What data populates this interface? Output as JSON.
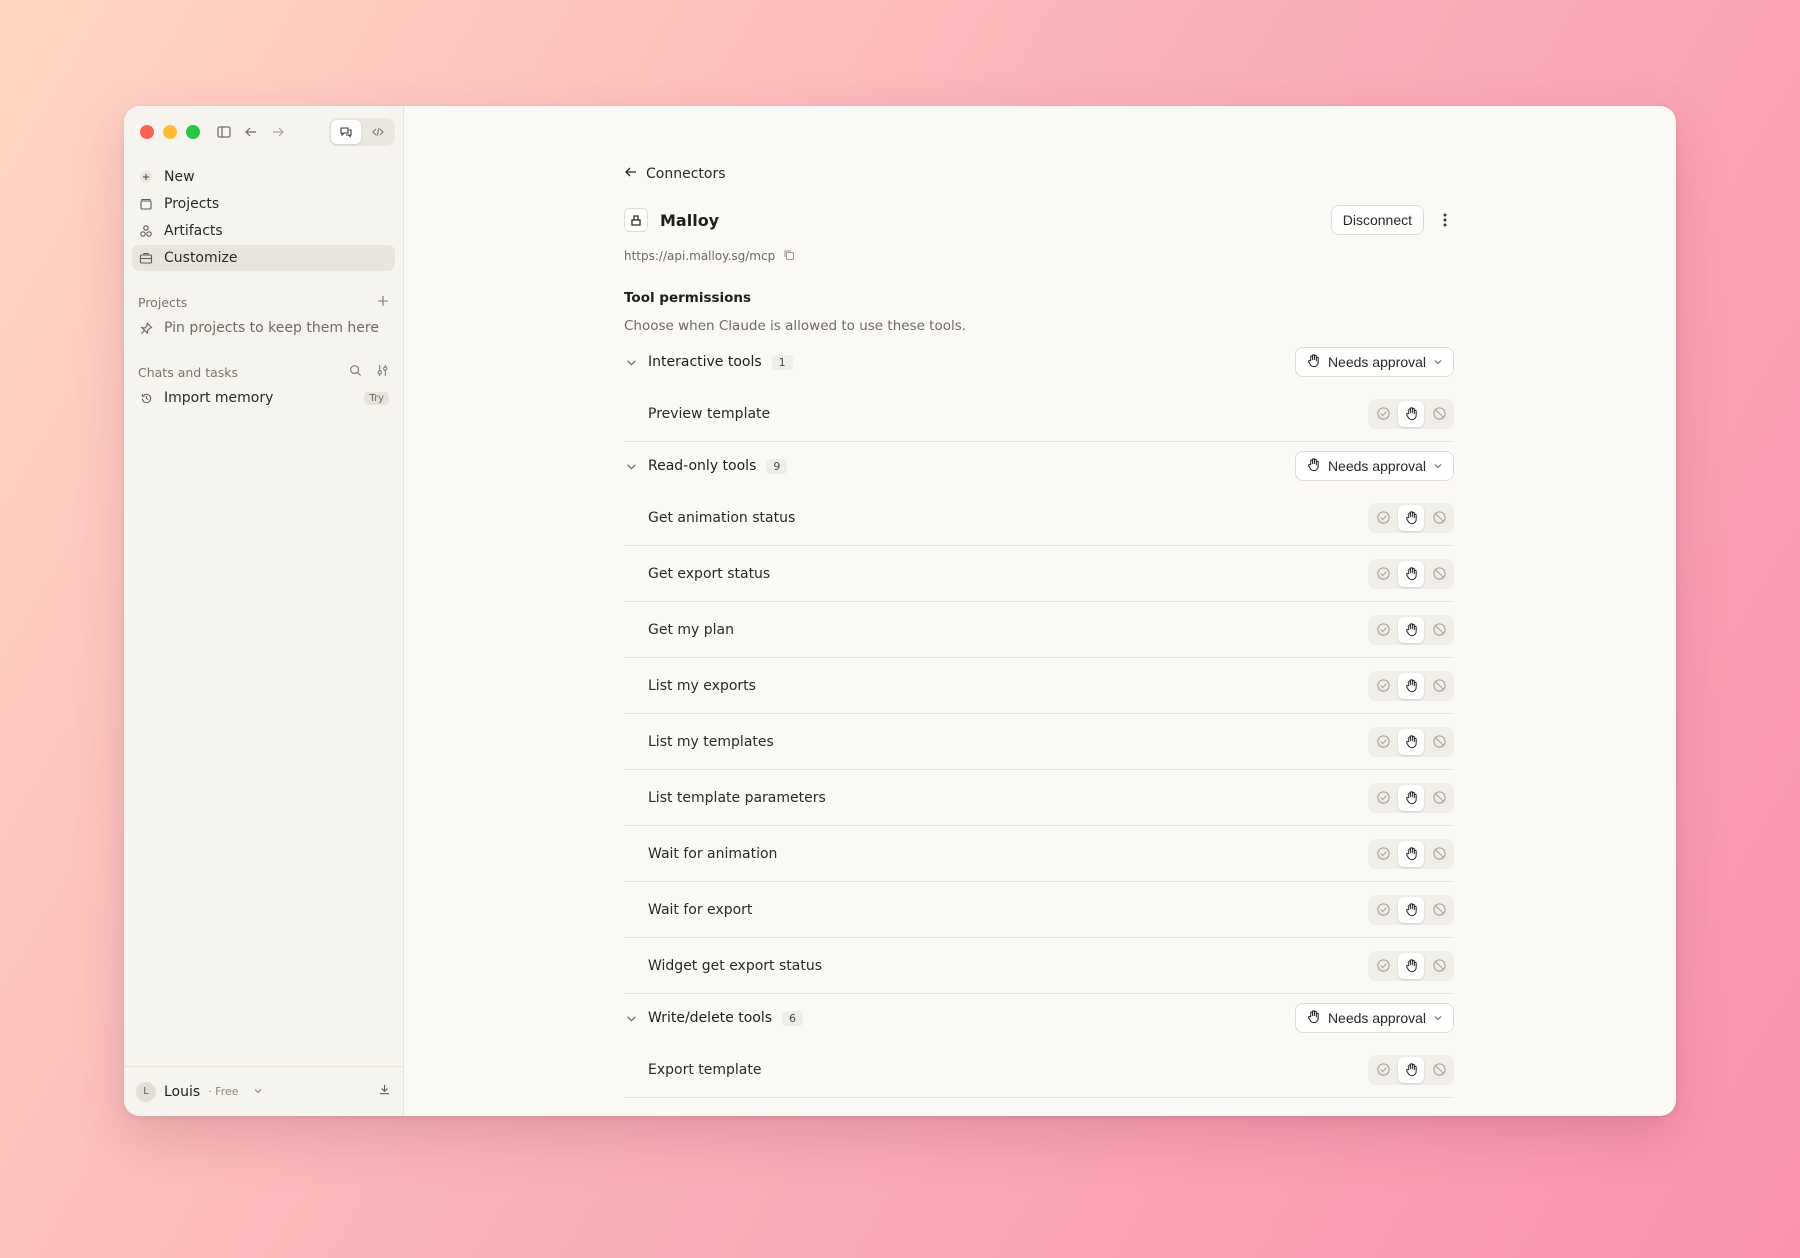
{
  "sidebar": {
    "nav": [
      {
        "label": "New",
        "icon": "plus-icon"
      },
      {
        "label": "Projects",
        "icon": "folder-icon"
      },
      {
        "label": "Artifacts",
        "icon": "artifacts-icon"
      },
      {
        "label": "Customize",
        "icon": "briefcase-icon",
        "active": true
      }
    ],
    "projects_heading": "Projects",
    "projects_empty": "Pin projects to keep them here",
    "chats_heading": "Chats and tasks",
    "import_memory": "Import memory",
    "try_badge": "Try",
    "user": {
      "initial": "L",
      "name": "Louis",
      "plan": "· Free"
    }
  },
  "main": {
    "back_label": "Connectors",
    "connector_name": "Malloy",
    "disconnect_label": "Disconnect",
    "url": "https://api.malloy.sg/mcp",
    "perm_title": "Tool permissions",
    "perm_sub": "Choose when Claude is allowed to use these tools.",
    "approval_label": "Needs approval",
    "groups": [
      {
        "label": "Interactive tools",
        "count": "1",
        "tools": [
          "Preview template"
        ]
      },
      {
        "label": "Read-only tools",
        "count": "9",
        "tools": [
          "Get animation status",
          "Get export status",
          "Get my plan",
          "List my exports",
          "List my templates",
          "List template parameters",
          "Wait for animation",
          "Wait for export",
          "Widget get export status"
        ]
      },
      {
        "label": "Write/delete tools",
        "count": "6",
        "tools": [
          "Export template"
        ]
      }
    ]
  },
  "colors": {
    "close": "#fe5f57",
    "minimize": "#febc2e",
    "zoom": "#28c840"
  }
}
